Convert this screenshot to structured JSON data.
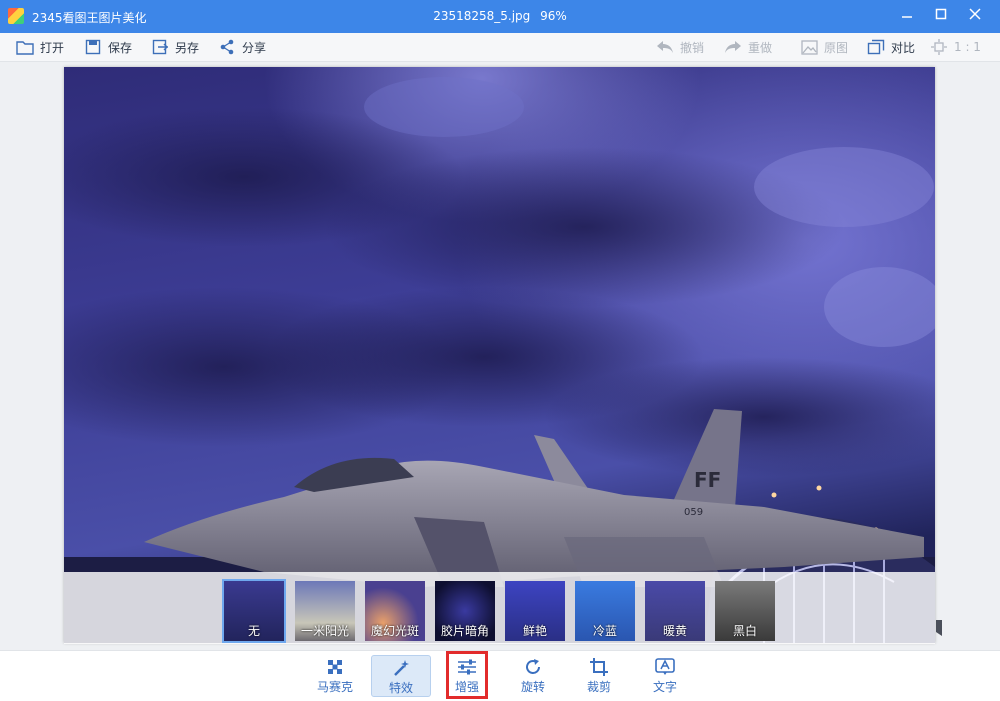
{
  "window": {
    "app_title": "2345看图王图片美化",
    "file_name": "23518258_5.jpg",
    "zoom": "96%",
    "controls": [
      "minimize",
      "maximize",
      "close"
    ]
  },
  "toolbar": {
    "open": "打开",
    "save": "保存",
    "save_as": "另存",
    "share": "分享",
    "undo": "撤销",
    "redo": "重做",
    "original": "原图",
    "compare": "对比",
    "actual_size": "1 : 1"
  },
  "filters": [
    {
      "label": "无",
      "selected": true
    },
    {
      "label": "一米阳光",
      "selected": false
    },
    {
      "label": "魔幻光斑",
      "selected": false
    },
    {
      "label": "胶片暗角",
      "selected": false
    },
    {
      "label": "鲜艳",
      "selected": false
    },
    {
      "label": "冷蓝",
      "selected": false
    },
    {
      "label": "暖黄",
      "selected": false
    },
    {
      "label": "黑白",
      "selected": false
    }
  ],
  "photo": {
    "tail_marking": "FF",
    "tail_number": "059"
  },
  "bottom_tools": [
    {
      "label": "马赛克",
      "icon": "mosaic-icon",
      "active": false
    },
    {
      "label": "特效",
      "icon": "magic-wand-icon",
      "active": true
    },
    {
      "label": "增强",
      "icon": "sliders-icon",
      "active": false,
      "highlighted": true
    },
    {
      "label": "旋转",
      "icon": "rotate-icon",
      "active": false
    },
    {
      "label": "裁剪",
      "icon": "crop-icon",
      "active": false
    },
    {
      "label": "文字",
      "icon": "text-icon",
      "active": false
    }
  ],
  "colors": {
    "titlebar": "#3d86e8",
    "accent": "#3a6fbf",
    "highlight": "#e22b2b",
    "sky": "#3b3a8c"
  }
}
